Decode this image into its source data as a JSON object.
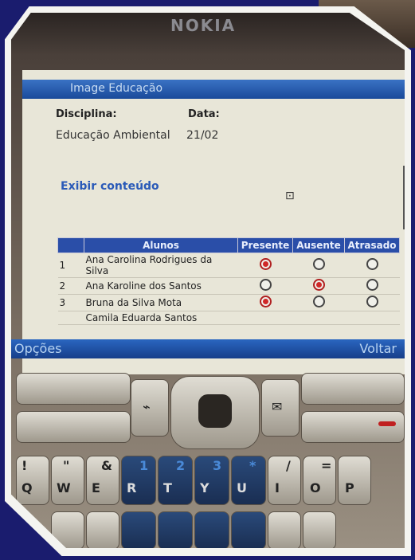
{
  "phone": {
    "brand": "NOKIA"
  },
  "app": {
    "title": "Image Educação"
  },
  "form": {
    "disciplina_label": "Disciplina:",
    "data_label": "Data:",
    "disciplina_value": "Educação Ambiental",
    "data_value": "21/02",
    "link": "Exibir conteúdo"
  },
  "table": {
    "headers": [
      "",
      "Alunos",
      "Presente",
      "Ausente",
      "Atrasado"
    ],
    "rows": [
      {
        "num": "1",
        "name": "Ana Carolina Rodrigues da Silva",
        "status": "Presente"
      },
      {
        "num": "2",
        "name": "Ana Karoline dos Santos",
        "status": "Ausente"
      },
      {
        "num": "3",
        "name": "Bruna da Silva Mota",
        "status": "Presente"
      },
      {
        "num": "",
        "name": "Camila Eduarda Santos",
        "status": ""
      }
    ]
  },
  "softkeys": {
    "left": "Opções",
    "right": "Voltar"
  },
  "keypad": {
    "row1": [
      "!",
      "\"",
      "&",
      "1",
      "2",
      "3",
      "*",
      "/",
      "=",
      "P"
    ],
    "row1_letters": [
      "Q",
      "W",
      "E",
      "R",
      "T",
      "Y",
      "U",
      "I",
      "O",
      "P"
    ]
  }
}
